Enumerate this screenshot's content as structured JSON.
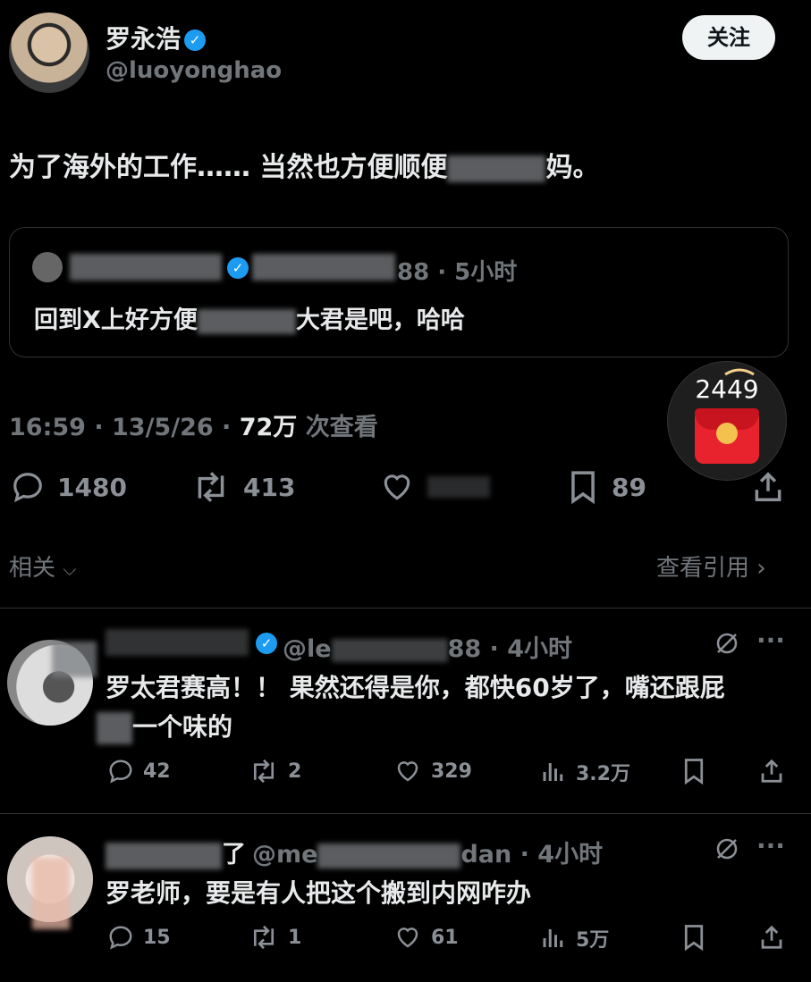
{
  "tweet": {
    "author_name": "罗永浩",
    "author_handle": "@luoyonghao",
    "follow_label": "关注",
    "text": "为了海外的工作…… 当然也方便顺便",
    "text_tail": "妈。",
    "quote": {
      "meta_tail": "88 · 5小时",
      "text_head": "回到X上好方便",
      "text_tail": "大君是吧，哈哈"
    },
    "time": "16:59 · 13/5/26 · ",
    "views": "72万",
    "views_label": " 次查看",
    "stats": {
      "replies": "1480",
      "retweets": "413",
      "bookmarks": "89"
    }
  },
  "related": {
    "label": "相关",
    "quotes_link": "查看引用"
  },
  "overlay": {
    "redpacket_count": "2449"
  },
  "replies": [
    {
      "handle_head": "@le",
      "meta_tail": "88 · 4小时",
      "text_line1": "罗太君赛高！！ 果然还得是你，都快60岁了，嘴还跟屁",
      "text_line2": "一个味的",
      "replies": "42",
      "retweets": "2",
      "likes": "329",
      "views": "3.2万"
    },
    {
      "name_tail": "了",
      "handle_head": "@me",
      "meta_tail": "dan · 4小时",
      "text": "罗老师，要是有人把这个搬到内网咋办",
      "replies": "15",
      "retweets": "1",
      "likes": "61",
      "views": "5万"
    }
  ]
}
